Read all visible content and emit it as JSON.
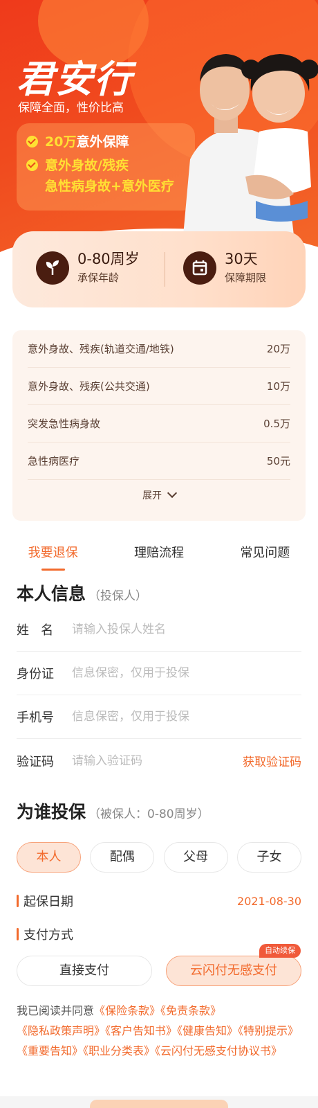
{
  "hero": {
    "title": "君安行",
    "subtitle": "保障全面，性价比高",
    "line1_highlight": "20万",
    "line1_rest": "意外保障",
    "line2a": "意外身故/残疾",
    "line2b": "急性病身故+意外医疗"
  },
  "info": {
    "age_value": "0-80周岁",
    "age_label": "承保年龄",
    "period_value": "30天",
    "period_label": "保障期限"
  },
  "coverage": {
    "rows": [
      {
        "name": "意外身故、残疾(轨道交通/地铁)",
        "amount": "20万"
      },
      {
        "name": "意外身故、残疾(公共交通)",
        "amount": "10万"
      },
      {
        "name": "突发急性病身故",
        "amount": "0.5万"
      },
      {
        "name": "急性病医疗",
        "amount": "50元"
      }
    ],
    "expand_label": "展开"
  },
  "tabs": [
    "我要退保",
    "理赔流程",
    "常见问题"
  ],
  "personal": {
    "title": "本人信息",
    "note": "（投保人）",
    "name_label": "姓   名",
    "name_placeholder": "请输入投保人姓名",
    "id_label": "身份证",
    "id_placeholder": "信息保密，仅用于投保",
    "phone_label": "手机号",
    "phone_placeholder": "信息保密，仅用于投保",
    "code_label": "验证码",
    "code_placeholder": "请输入验证码",
    "code_action": "获取验证码"
  },
  "insured": {
    "title": "为谁投保",
    "note": "（被保人：0-80周岁）",
    "options": [
      "本人",
      "配偶",
      "父母",
      "子女"
    ]
  },
  "start_date": {
    "label": "起保日期",
    "value": "2021-08-30"
  },
  "payment": {
    "label": "支付方式",
    "direct": "直接支付",
    "quickpass": "云闪付无感支付",
    "badge": "自动续保"
  },
  "agreement": {
    "prefix": "我已阅读并同意",
    "docs": [
      "《保险条款》",
      "《免责条款》",
      "《隐私政策声明》",
      "《客户告知书》",
      "《健康告知》",
      "《特别提示》",
      "《重要告知》",
      "《职业分类表》",
      "《云闪付无感支付协议书》"
    ]
  },
  "colors": {
    "accent": "#f26a2c",
    "hero": "#ef3a1b",
    "highlight": "#ffe033"
  }
}
